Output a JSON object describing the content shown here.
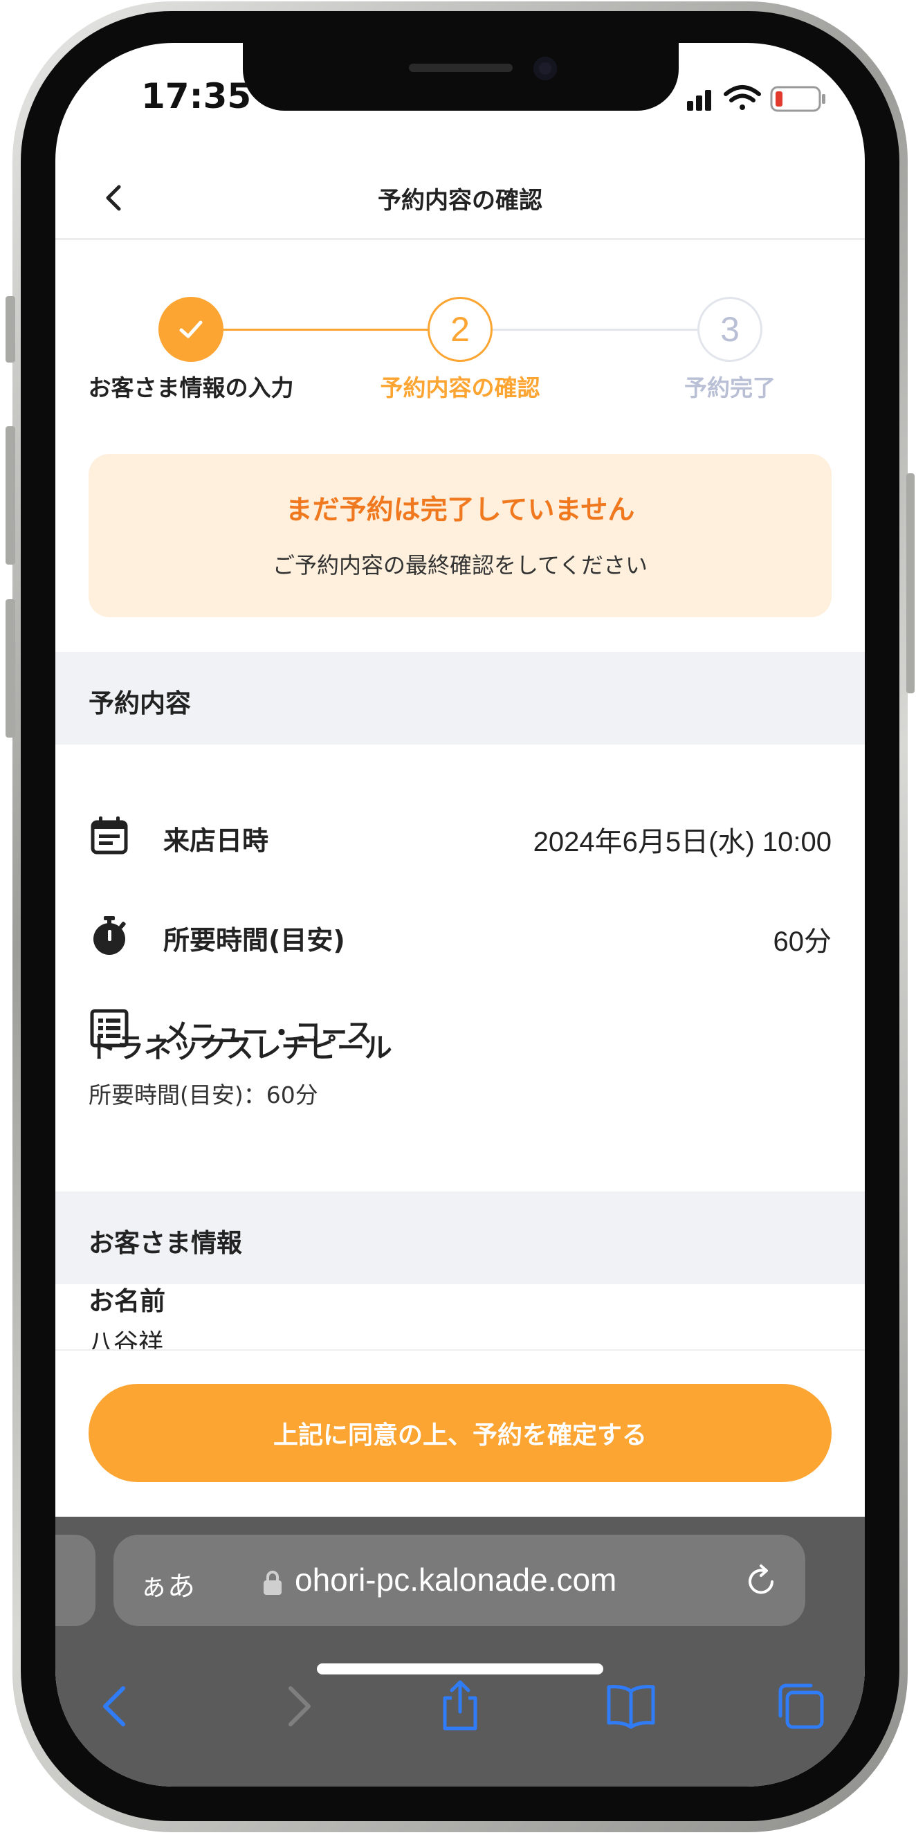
{
  "status": {
    "time": "17:35"
  },
  "nav": {
    "title": "予約内容の確認"
  },
  "stepper": {
    "steps": [
      {
        "number": "✓",
        "label": "お客さま情報の入力"
      },
      {
        "number": "2",
        "label": "予約内容の確認"
      },
      {
        "number": "3",
        "label": "予約完了"
      }
    ]
  },
  "warning": {
    "title": "まだ予約は完了していません",
    "subtitle": "ご予約内容の最終確認をしてください"
  },
  "reservation": {
    "section_title": "予約内容",
    "visit_label": "来店日時",
    "visit_value": "2024年6月5日(水) 10:00",
    "duration_label": "所要時間(目安)",
    "duration_value": "60分",
    "menu_label": "メニュー・コース",
    "course_name": "トラネックスレチピール",
    "course_duration": "所要時間(目安)：60分"
  },
  "customer": {
    "section_title": "お客さま情報",
    "name_label": "お名前",
    "name_value": "八谷祥"
  },
  "footer": {
    "confirm_label": "上記に同意の上、予約を確定する"
  },
  "browser": {
    "aa_label": "ぁあ",
    "url": "ohori-pc.kalonade.com"
  },
  "colors": {
    "accent": "#fca532",
    "accent_text": "#f0791f",
    "inactive": "#b9c0d6",
    "warning_bg": "#fef0dd",
    "safari_blue": "#2f7cf6"
  }
}
